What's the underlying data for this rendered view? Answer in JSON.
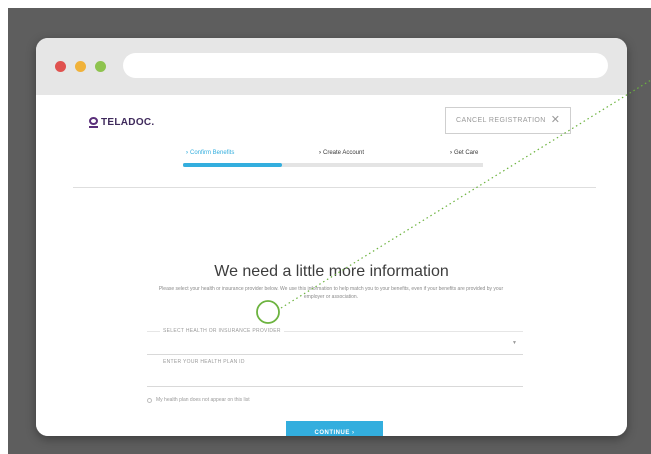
{
  "header": {
    "logo_text": "TELADOC.",
    "cancel_label": "CANCEL REGISTRATION",
    "cancel_icon": "close-icon"
  },
  "steps": [
    {
      "label": "Confirm Benefits",
      "status": "active"
    },
    {
      "label": "Create Account",
      "status": "upcoming"
    },
    {
      "label": "Get Care",
      "status": "upcoming"
    }
  ],
  "progress": {
    "fraction": 0.33,
    "color": "#33aede"
  },
  "main": {
    "heading": "We need a little more information",
    "intro": "Please select your health or insurance provider below. We use this information to help match you to your benefits, even if your benefits are provided by your employer or association."
  },
  "form": {
    "provider_label": "SELECT HEALTH OR INSURANCE PROVIDER",
    "provider_value": "",
    "plan_id_label": "ENTER YOUR HEALTH PLAN ID",
    "plan_id_value": "",
    "not_listed_label": "My health plan does not appear on this list",
    "continue_label": "CONTINUE ›"
  },
  "colors": {
    "accent": "#33aede",
    "brand": "#3f2a5c",
    "highlight": "#6cb33f",
    "backdrop": "#5e5e5e"
  }
}
